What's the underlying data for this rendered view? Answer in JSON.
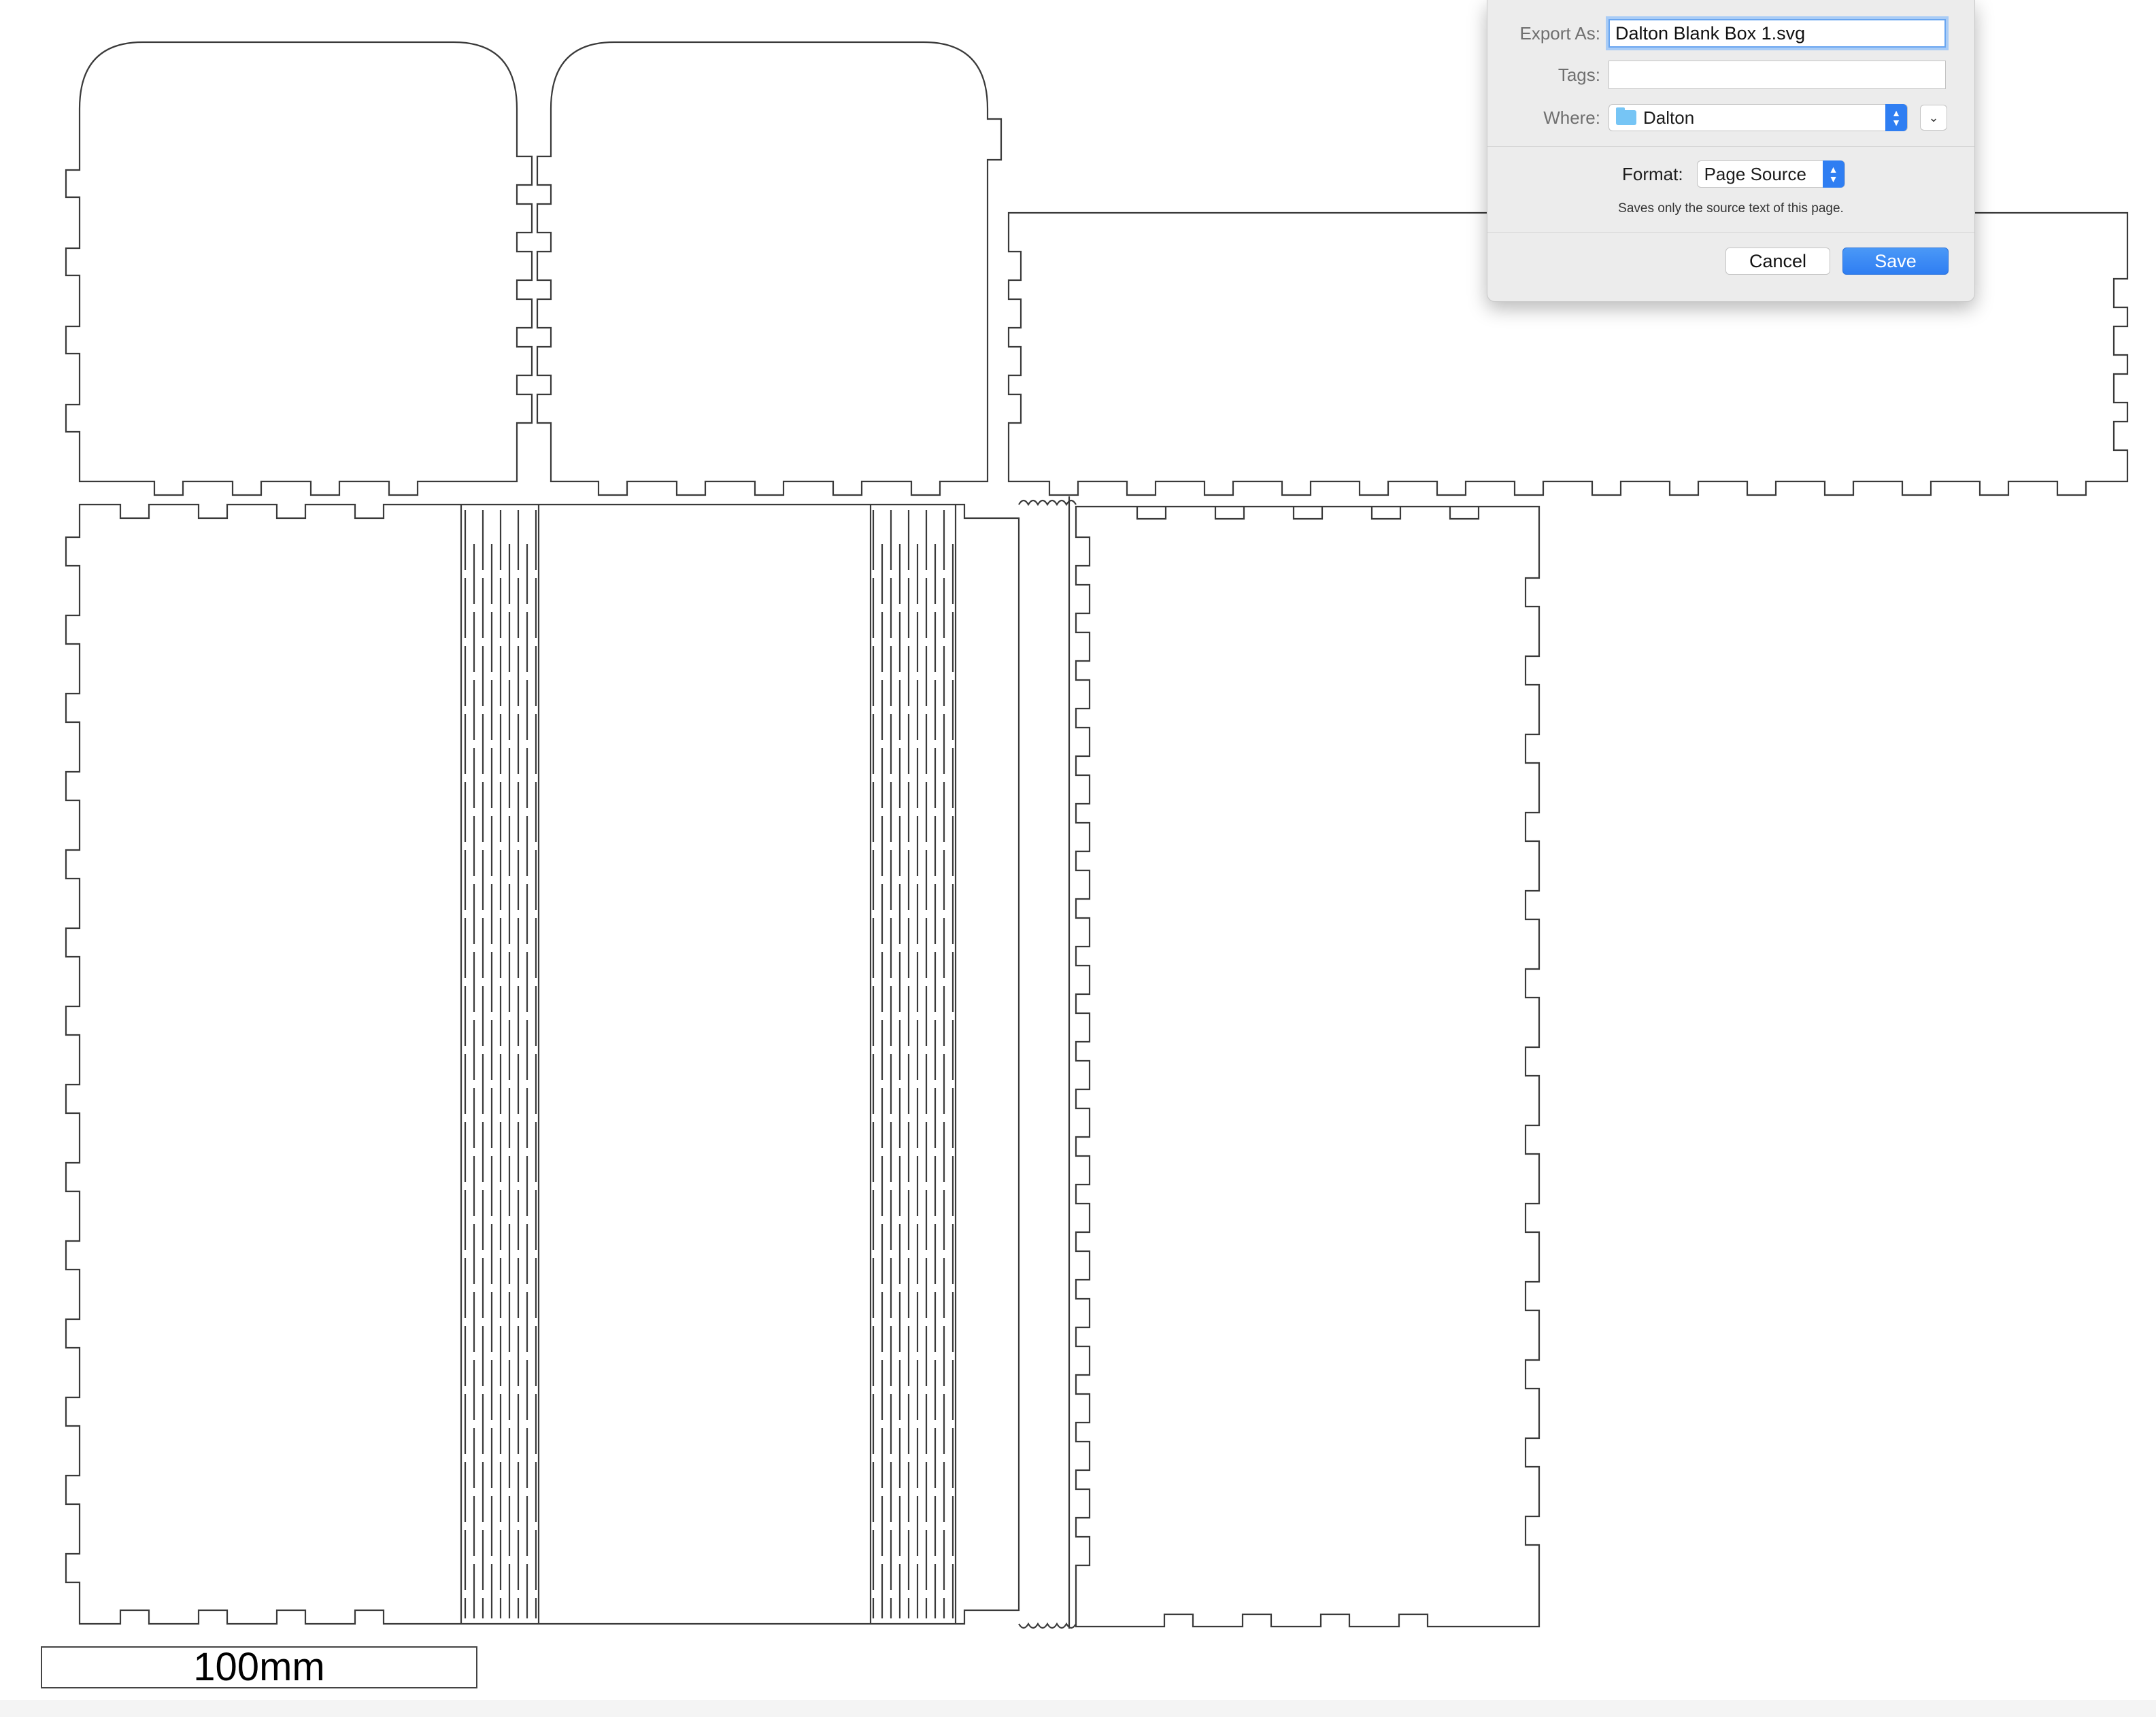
{
  "scale_label": "100mm",
  "dialog": {
    "export_as_label": "Export As:",
    "export_as_value": "Dalton Blank Box 1.svg",
    "tags_label": "Tags:",
    "tags_value": "",
    "where_label": "Where:",
    "where_value": "Dalton",
    "format_label": "Format:",
    "format_value": "Page Source",
    "format_hint": "Saves only the source text of this page.",
    "cancel_label": "Cancel",
    "save_label": "Save",
    "icons": {
      "folder": "folder-icon",
      "stepper": "up-down-chevron-icon",
      "expand": "chevron-down-icon"
    }
  },
  "colors": {
    "accent": "#2f7ef2",
    "folder": "#76c5f5",
    "focus_ring": "#a9ccf6",
    "line": "#3a3a3a"
  }
}
